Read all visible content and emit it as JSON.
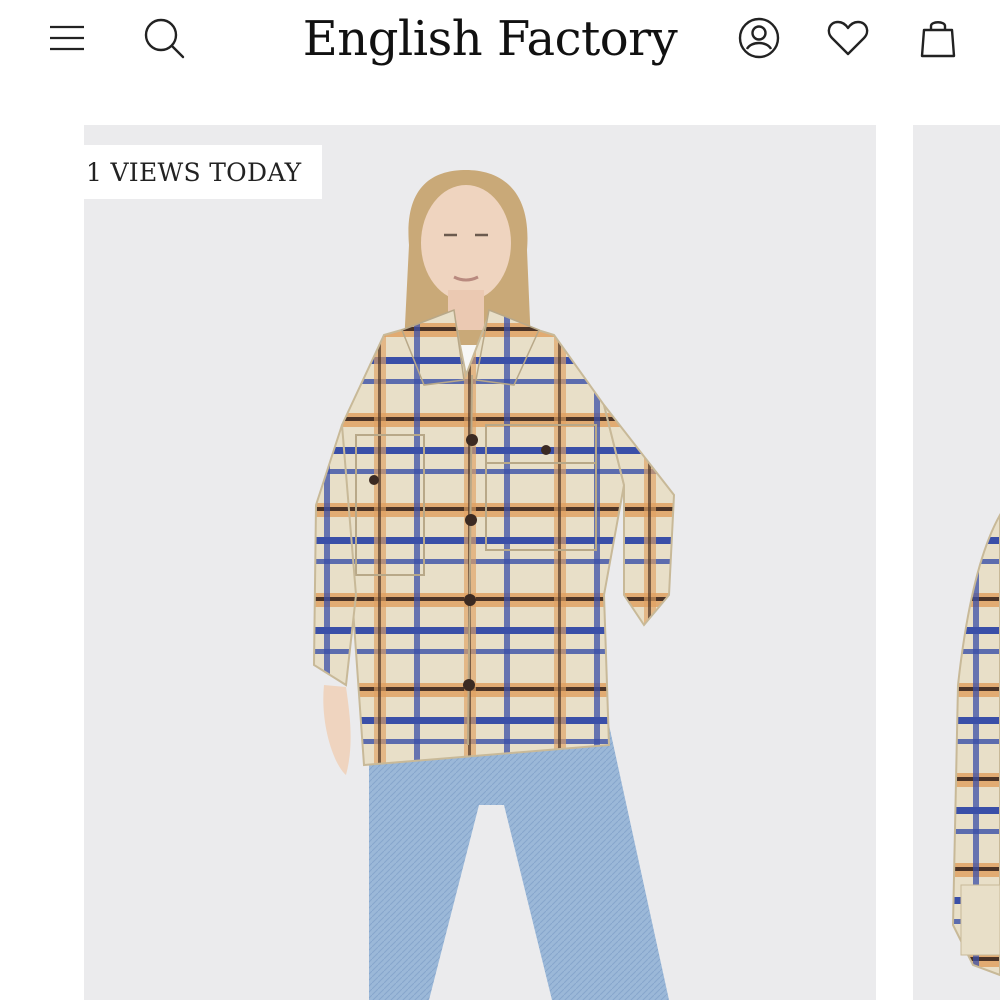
{
  "header": {
    "brand": "English Factory",
    "icons": {
      "menu": "menu-icon",
      "search": "search-icon",
      "account": "user-icon",
      "wishlist": "heart-icon",
      "cart": "bag-icon"
    }
  },
  "product_gallery": {
    "views_badge": "1 VIEWS TODAY",
    "images": [
      "model-wearing-plaid-shacket",
      "plaid-shacket-side-view"
    ]
  },
  "colors": {
    "background": "#ffffff",
    "photo_background": "#ebebed",
    "text": "#111111",
    "plaid_cream": "#e8dfc8",
    "plaid_orange": "#e0a263",
    "plaid_blue": "#3a4fa8",
    "plaid_brown": "#4a3326",
    "denim": "#9bb8d8"
  }
}
